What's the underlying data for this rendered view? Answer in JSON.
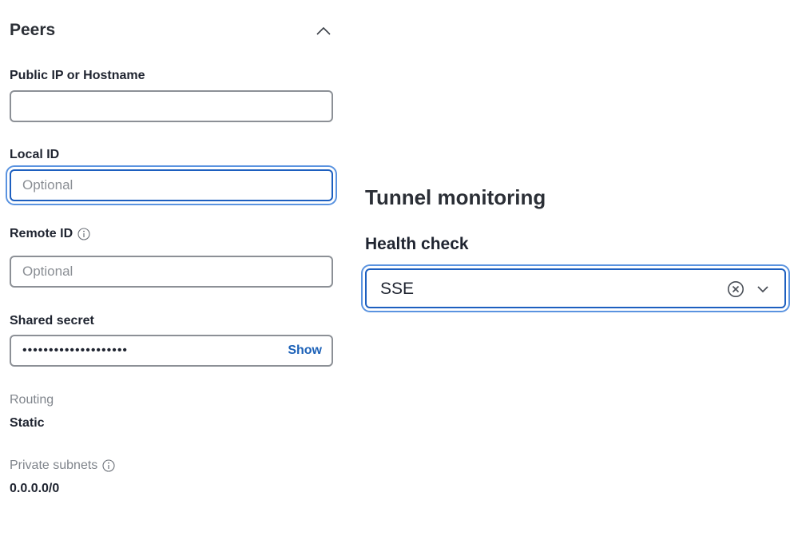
{
  "peers": {
    "title": "Peers",
    "collapse_icon": "chevron-up-icon"
  },
  "fields": {
    "public_ip": {
      "label": "Public IP or Hostname",
      "value": "",
      "placeholder": ""
    },
    "local_id": {
      "label": "Local ID",
      "value": "",
      "placeholder": "Optional"
    },
    "remote_id": {
      "label": "Remote ID",
      "value": "",
      "placeholder": "Optional",
      "icon": "info-icon"
    },
    "shared_secret": {
      "label": "Shared secret",
      "masked_value": "••••••••••••••••••••",
      "show_label": "Show"
    }
  },
  "routing": {
    "label": "Routing",
    "value": "Static"
  },
  "private_subnets": {
    "label": "Private subnets",
    "value": "0.0.0.0/0",
    "icon": "info-icon"
  },
  "tunnel_monitoring": {
    "title": "Tunnel monitoring",
    "health_check": {
      "label": "Health check",
      "selected": "SSE",
      "clear_icon": "clear-circle-icon",
      "dropdown_icon": "chevron-down-icon"
    }
  },
  "colors": {
    "focus_border": "#1d5fbf",
    "focus_ring": "#5a93e0",
    "link": "#1d62b8",
    "input_border": "#8c9096"
  }
}
